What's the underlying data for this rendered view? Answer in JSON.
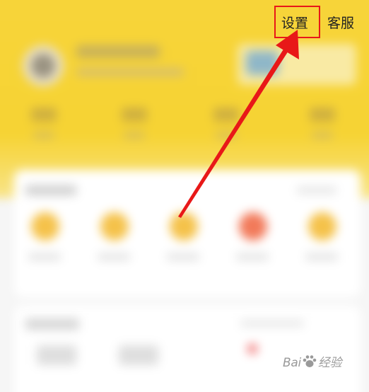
{
  "header": {
    "settings_label": "设置",
    "service_label": "客服"
  },
  "annotation": {
    "highlight_color": "#e81818",
    "arrow_color": "#e81818"
  },
  "watermark": {
    "brand_prefix": "Bai",
    "brand_suffix": "经验"
  },
  "colors": {
    "header_yellow": "#f6d333",
    "card_white": "#ffffff"
  }
}
